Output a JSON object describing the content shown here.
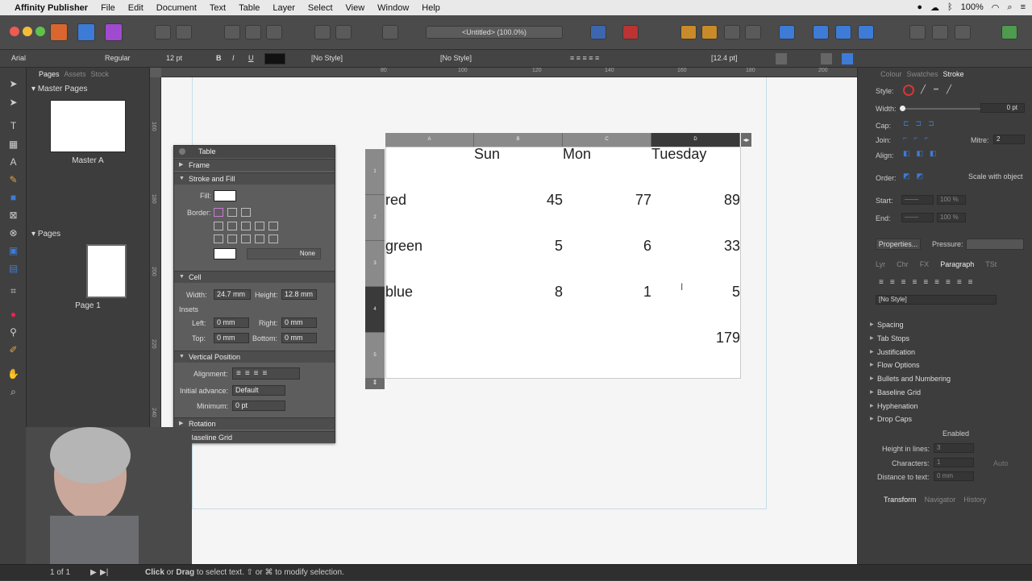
{
  "menubar": {
    "app": "Affinity Publisher",
    "items": [
      "File",
      "Edit",
      "Document",
      "Text",
      "Table",
      "Layer",
      "Select",
      "View",
      "Window",
      "Help"
    ],
    "battery": "100%",
    "clock": "≡"
  },
  "toolbar": {
    "doc_title": "<Untitled> (100.0%)"
  },
  "context": {
    "font": "Arial",
    "style": "Regular",
    "size": "12 pt",
    "char_style": "[No Style]",
    "para_style": "[No Style]",
    "leading": "[12.4 pt]"
  },
  "left_panel": {
    "tabs": [
      "Pages",
      "Assets",
      "Stock"
    ],
    "master_pages_label": "Master Pages",
    "master_a": "Master A",
    "pages_label": "Pages",
    "page_1": "Page 1"
  },
  "ruler": {
    "top": [
      "80",
      "100",
      "120",
      "140",
      "160",
      "180",
      "200"
    ],
    "left": [
      "160",
      "180",
      "200",
      "220",
      "240",
      "260"
    ]
  },
  "table_panel": {
    "title": "Table",
    "frame": "Frame",
    "stroke_fill": "Stroke and Fill",
    "fill": "Fill:",
    "border": "Border:",
    "none": "None",
    "cell": "Cell",
    "width_label": "Width:",
    "width": "24.7 mm",
    "height_label": "Height:",
    "height": "12.8 mm",
    "insets": "Insets",
    "left_label": "Left:",
    "left": "0 mm",
    "right_label": "Right:",
    "right": "0 mm",
    "top_label": "Top:",
    "top": "0 mm",
    "bottom_label": "Bottom:",
    "bottom": "0 mm",
    "vertical_position": "Vertical Position",
    "alignment": "Alignment:",
    "initial_advance": "Initial advance:",
    "initial_advance_value": "Default",
    "minimum": "Minimum:",
    "minimum_value": "0 pt",
    "rotation": "Rotation",
    "baseline_grid": "Baseline Grid"
  },
  "doc_table": {
    "col_headers": [
      "A",
      "B",
      "C",
      "D"
    ],
    "row_headers": [
      "1",
      "2",
      "3",
      "4",
      "5"
    ],
    "rows": [
      [
        "",
        "Sun",
        "Mon",
        "Tuesday"
      ],
      [
        "red",
        "45",
        "77",
        "89"
      ],
      [
        "green",
        "5",
        "6",
        "33"
      ],
      [
        "blue",
        "8",
        "1",
        "5"
      ],
      [
        "",
        "",
        "",
        "179"
      ]
    ]
  },
  "right_panel": {
    "tabs": [
      "Colour",
      "Swatches",
      "Stroke"
    ],
    "style": "Style:",
    "width": "Width:",
    "width_value": "0 pt",
    "cap": "Cap:",
    "join": "Join:",
    "mitre": "Mitre:",
    "mitre_value": "2",
    "align": "Align:",
    "order": "Order:",
    "scale_with_object": "Scale with object",
    "start": "Start:",
    "end": "End:",
    "arrow_scale": "100 %",
    "properties": "Properties...",
    "pressure": "Pressure:",
    "tabs2": [
      "Lyr",
      "Chr",
      "FX",
      "Paragraph",
      "TSt"
    ],
    "para_style": "[No Style]",
    "sections": [
      "Spacing",
      "Tab Stops",
      "Justification",
      "Flow Options",
      "Bullets and Numbering",
      "Baseline Grid",
      "Hyphenation",
      "Drop Caps"
    ],
    "enabled": "Enabled",
    "height_in_lines": "Height in lines:",
    "height_in_lines_value": "3",
    "characters": "Characters:",
    "characters_value": "1",
    "auto": "Auto",
    "distance_to_text": "Distance to text:",
    "distance_value": "0 mm",
    "tabs3": [
      "Transform",
      "Navigator",
      "History"
    ]
  },
  "status": {
    "page": "1 of 1",
    "hint_bold_1": "Click",
    "hint_or": " or ",
    "hint_bold_2": "Drag",
    "hint_rest": " to select text. ⇧ or ⌘ to modify selection."
  }
}
